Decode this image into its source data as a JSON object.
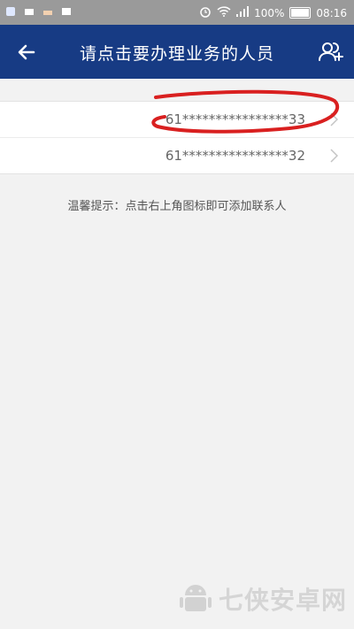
{
  "status_bar": {
    "battery_percent": "100%",
    "time": "08:16"
  },
  "header": {
    "title": "请点击要办理业务的人员"
  },
  "contacts": [
    {
      "number": "61****************33"
    },
    {
      "number": "61****************32"
    }
  ],
  "hint": "温馨提示：点击右上角图标即可添加联系人",
  "watermark": {
    "text": "七侠安卓网"
  },
  "colors": {
    "header_bg": "#173b84",
    "page_bg": "#f2f2f2",
    "annotation": "#d92020"
  }
}
